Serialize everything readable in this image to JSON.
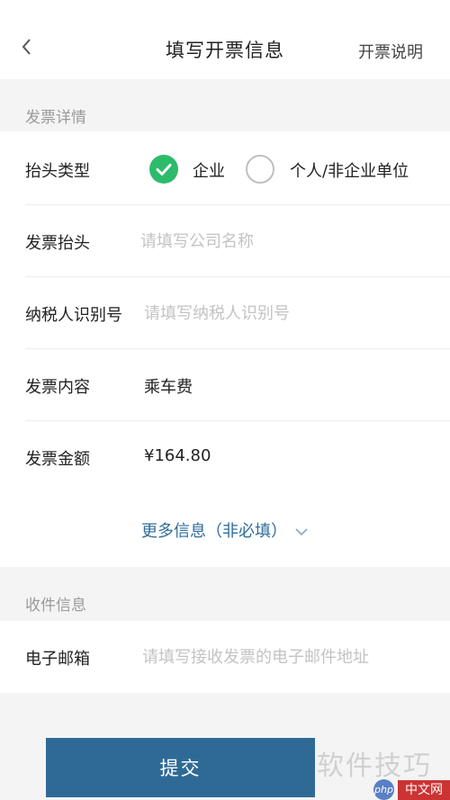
{
  "header": {
    "title": "填写开票信息",
    "right_action": "开票说明",
    "back_icon": "chevron-left-icon"
  },
  "invoice_section": {
    "title": "发票详情",
    "header_type": {
      "label": "抬头类型",
      "options": [
        "企业",
        "个人/非企业单位"
      ],
      "selected": "企业"
    },
    "invoice_header": {
      "label": "发票抬头",
      "placeholder": "请填写公司名称",
      "value": ""
    },
    "tax_id": {
      "label": "纳税人识别号",
      "placeholder": "请填写纳税人识别号",
      "value": ""
    },
    "content": {
      "label": "发票内容",
      "value": "乘车费"
    },
    "amount": {
      "label": "发票金额",
      "value": "¥164.80"
    },
    "more_link": "更多信息（非必填）"
  },
  "recipient_section": {
    "title": "收件信息",
    "email": {
      "label": "电子邮箱",
      "placeholder": "请填写接收发票的电子邮件地址",
      "value": ""
    }
  },
  "submit_label": "提交",
  "watermark": {
    "text": "软件技巧",
    "logo": "php",
    "site": "中文网"
  },
  "colors": {
    "accent": "#2f6a97",
    "check": "#2dbb6b",
    "link": "#2f6d9a",
    "placeholder": "#c3c3c3"
  }
}
